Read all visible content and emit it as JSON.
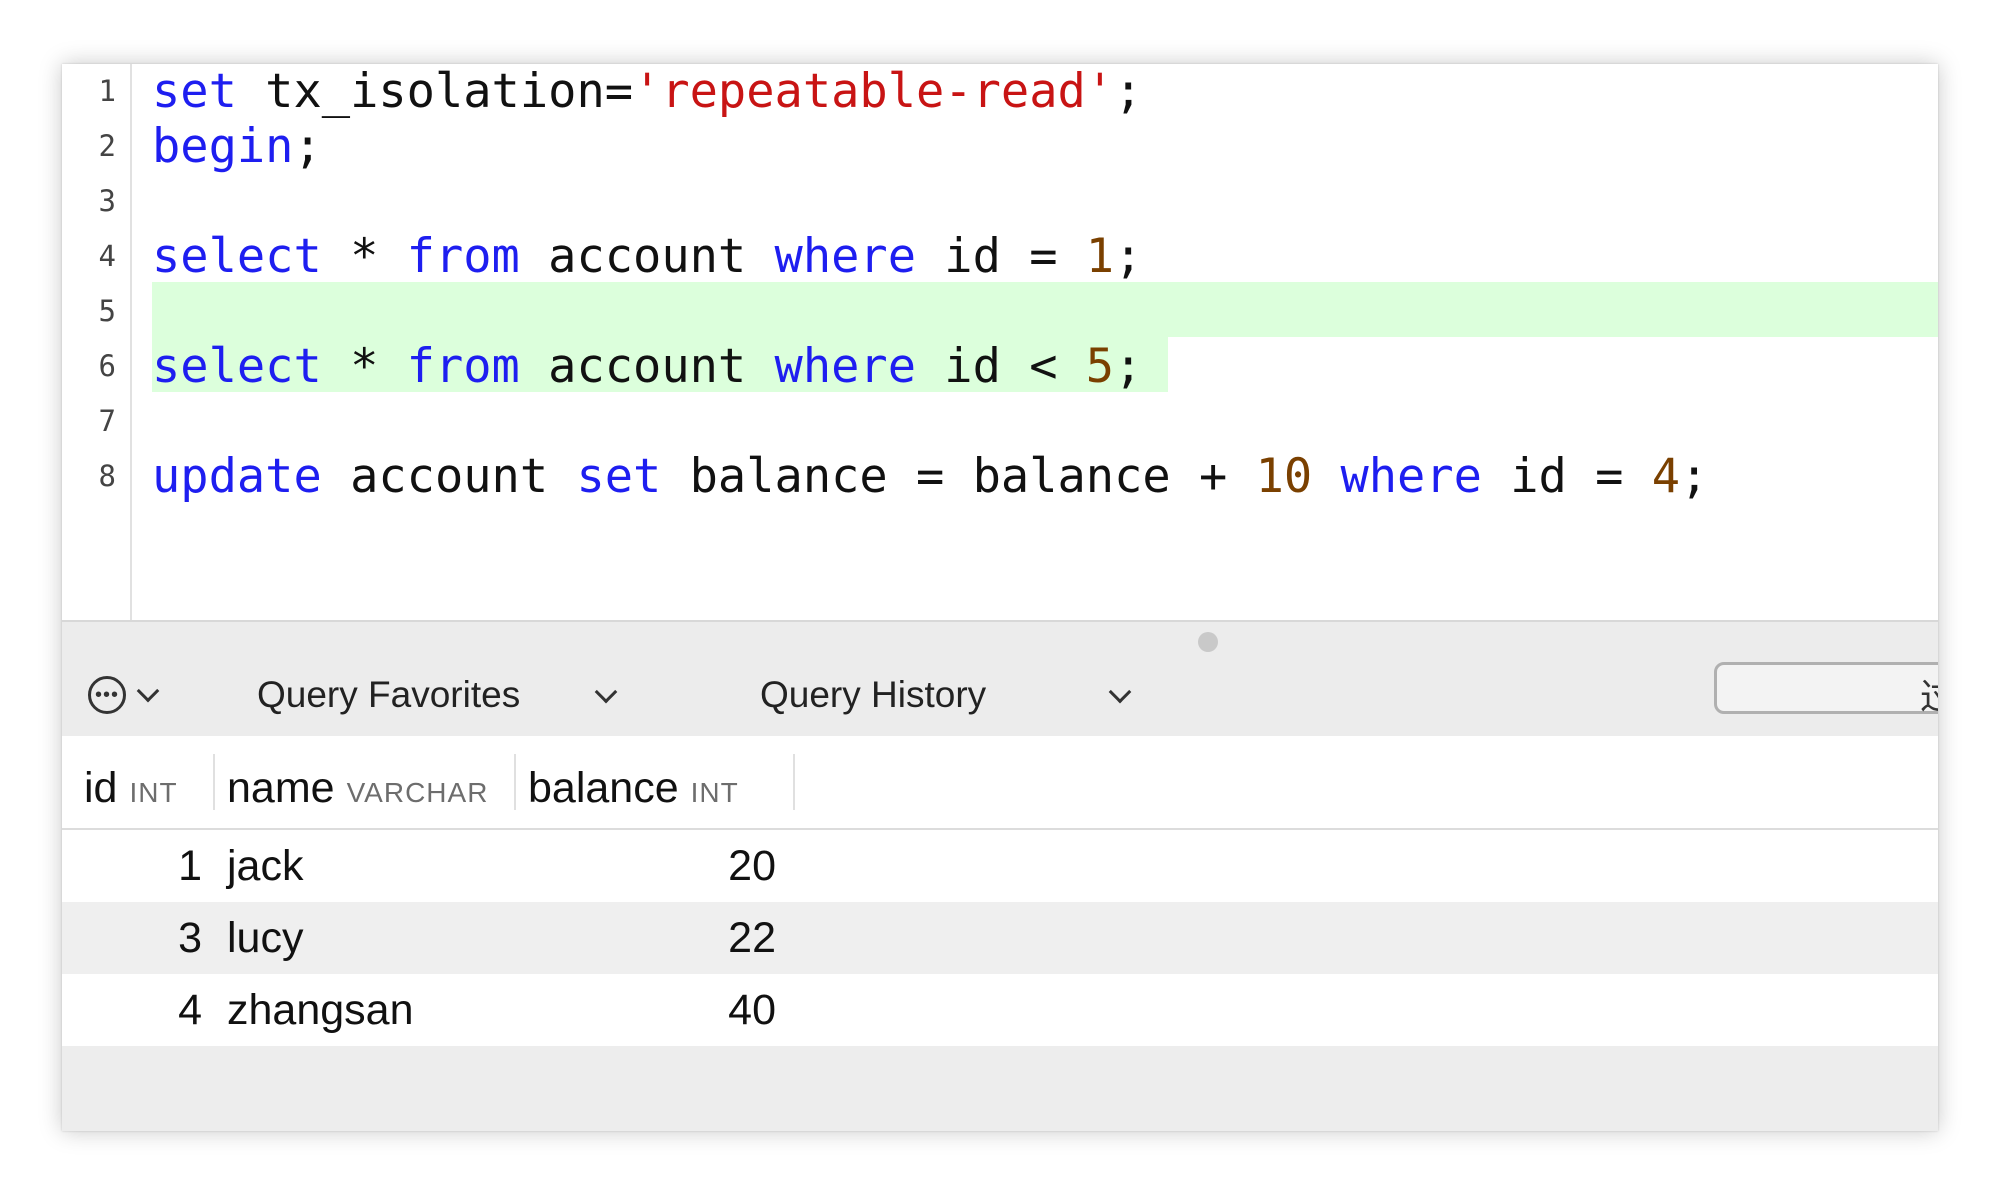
{
  "editor": {
    "line_numbers": [
      "1",
      "2",
      "3",
      "4",
      "5",
      "6",
      "7",
      "8"
    ],
    "lines": [
      [
        {
          "t": "set",
          "c": "kw"
        },
        {
          "t": " tx_isolation=",
          "c": ""
        },
        {
          "t": "'repeatable-read'",
          "c": "str"
        },
        {
          "t": ";",
          "c": ""
        }
      ],
      [
        {
          "t": "begin",
          "c": "kw"
        },
        {
          "t": ";",
          "c": ""
        }
      ],
      [],
      [
        {
          "t": "select",
          "c": "kw"
        },
        {
          "t": " * ",
          "c": ""
        },
        {
          "t": "from",
          "c": "kw"
        },
        {
          "t": " account ",
          "c": ""
        },
        {
          "t": "where",
          "c": "kw"
        },
        {
          "t": " id = ",
          "c": ""
        },
        {
          "t": "1",
          "c": "num"
        },
        {
          "t": ";",
          "c": ""
        }
      ],
      [],
      [
        {
          "t": "select",
          "c": "kw"
        },
        {
          "t": " * ",
          "c": ""
        },
        {
          "t": "from",
          "c": "kw"
        },
        {
          "t": " account ",
          "c": ""
        },
        {
          "t": "where",
          "c": "kw"
        },
        {
          "t": " id < ",
          "c": ""
        },
        {
          "t": "5",
          "c": "num"
        },
        {
          "t": ";",
          "c": ""
        }
      ],
      [],
      [
        {
          "t": "update",
          "c": "kw"
        },
        {
          "t": " account ",
          "c": ""
        },
        {
          "t": "set",
          "c": "kw"
        },
        {
          "t": " balance = balance + ",
          "c": ""
        },
        {
          "t": "10",
          "c": "num"
        },
        {
          "t": " ",
          "c": ""
        },
        {
          "t": "where",
          "c": "kw"
        },
        {
          "t": " id = ",
          "c": ""
        },
        {
          "t": "4",
          "c": "num"
        },
        {
          "t": ";",
          "c": ""
        }
      ]
    ],
    "colors": {
      "keyword": "#1e1ef0",
      "string": "#c81414",
      "number": "#7a4000",
      "highlight": "#dcffdc"
    }
  },
  "toolbar": {
    "more_icon": "ellipsis-circle-icon",
    "favorites_label": "Query Favorites",
    "history_label": "Query History",
    "search_glyph": "过"
  },
  "results": {
    "columns": [
      {
        "name": "id",
        "type": "INT"
      },
      {
        "name": "name",
        "type": "VARCHAR"
      },
      {
        "name": "balance",
        "type": "INT"
      }
    ],
    "rows": [
      {
        "id": "1",
        "name": "jack",
        "balance": "20"
      },
      {
        "id": "3",
        "name": "lucy",
        "balance": "22"
      },
      {
        "id": "4",
        "name": "zhangsan",
        "balance": "40"
      }
    ]
  }
}
